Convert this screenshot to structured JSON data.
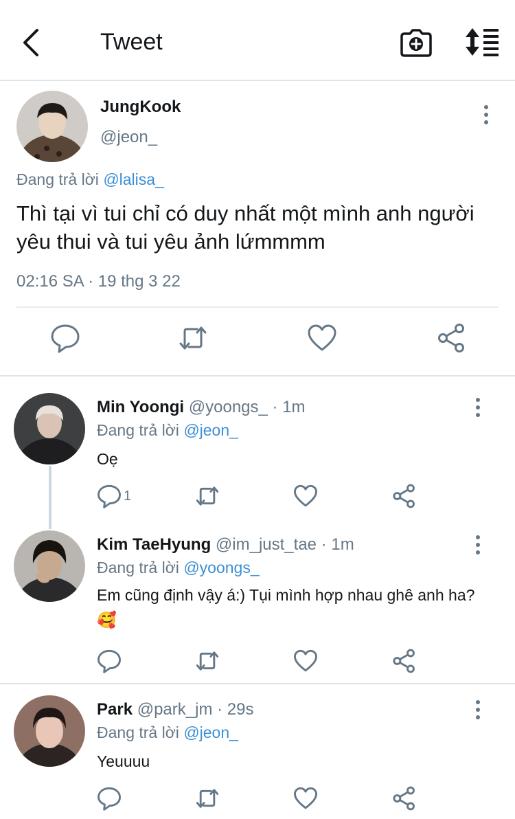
{
  "header": {
    "title": "Tweet"
  },
  "main_tweet": {
    "author_name": "JungKook",
    "handle": "@jeon_",
    "replying_to_prefix": "Đang trả lời",
    "replying_to_handle": "@lalisa_",
    "text": "Thì tại vì tui chỉ có duy nhất một mình anh người yêu thui và tui yêu ảnh lứmmmm",
    "timestamp": "02:16 SA · 19 thg 3 22"
  },
  "replies": [
    {
      "name": "Min Yoongi",
      "meta": "@yoongs_ · 1m",
      "replying_to_prefix": "Đang trả lời",
      "replying_to_handle": "@jeon_",
      "text": "Oẹ",
      "reply_count": "1"
    },
    {
      "name": "Kim TaeHyung",
      "meta": "@im_just_tae · 1m",
      "replying_to_prefix": "Đang trả lời",
      "replying_to_handle": "@yoongs_",
      "text": "Em cũng định vậy á:) Tụi mình hợp nhau ghê anh ha? 🥰",
      "reply_count": ""
    },
    {
      "name": "Park",
      "meta": "@park_jm · 29s",
      "replying_to_prefix": "Đang trả lời",
      "replying_to_handle": "@jeon_",
      "text": "Yeuuuu",
      "reply_count": ""
    }
  ],
  "colors": {
    "link": "#3b8fd6",
    "muted": "#657786",
    "text": "#14171a",
    "divider": "#e1e4e6"
  },
  "icons": [
    "back-arrow-icon",
    "camera-plus-icon",
    "sort-icon",
    "more-dots-icon",
    "reply-icon",
    "retweet-icon",
    "like-icon",
    "share-icon"
  ]
}
